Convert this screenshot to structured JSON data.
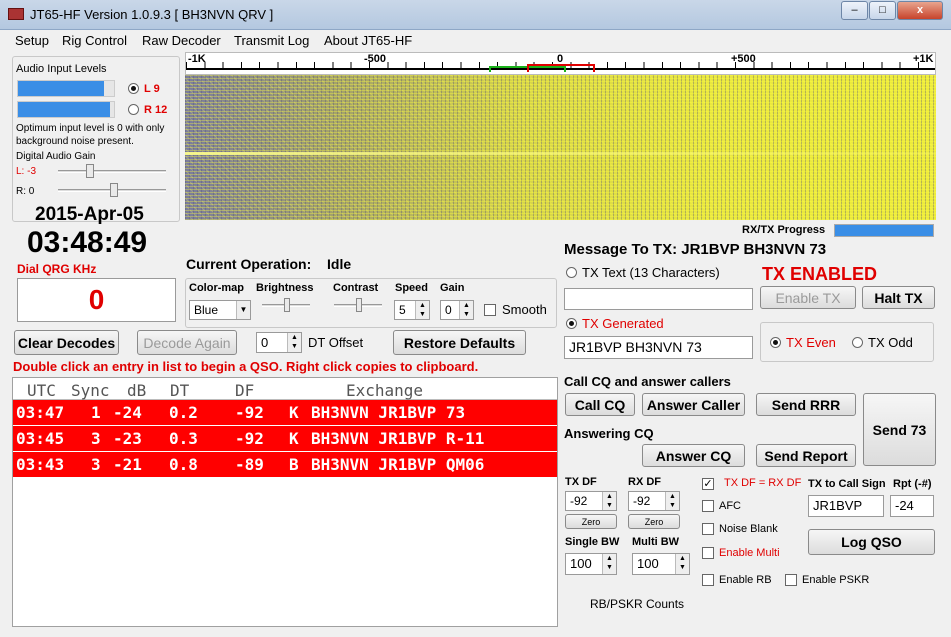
{
  "window": {
    "title": "JT65-HF Version 1.0.9.3  [ BH3NVN QRV ]",
    "minimize": "–",
    "maximize": "□",
    "close": "x"
  },
  "menu": [
    "Setup",
    "Rig Control",
    "Raw Decoder",
    "Transmit Log",
    "About JT65-HF"
  ],
  "audio": {
    "title": "Audio Input Levels",
    "left_label": "L 9",
    "right_label": "R 12",
    "left_level": 0.9,
    "right_level": 0.96,
    "hint": "Optimum input level is 0 with only background noise present.",
    "gain_title": "Digital Audio Gain",
    "gain_left": "L: -3",
    "gain_right": "R: 0"
  },
  "clock": {
    "date": "2015-Apr-05",
    "time": "03:48:49"
  },
  "dial": {
    "label": "Dial QRG KHz",
    "value": "0"
  },
  "scale": {
    "labels": [
      "-1K",
      "-500",
      "0",
      "+500",
      "+1K"
    ]
  },
  "progress": {
    "label": "RX/TX Progress",
    "fraction": 1.0
  },
  "operation": {
    "label": "Current Operation:",
    "value": "Idle"
  },
  "display": {
    "colormap_label": "Color-map",
    "colormap_value": "Blue",
    "brightness_label": "Brightness",
    "contrast_label": "Contrast",
    "speed_label": "Speed",
    "speed_value": "5",
    "gain_label": "Gain",
    "gain_value": "0",
    "smooth_label": "Smooth"
  },
  "buttons": {
    "clear_decodes": "Clear Decodes",
    "decode_again": "Decode Again",
    "restore_defaults": "Restore Defaults",
    "enable_tx": "Enable TX",
    "halt_tx": "Halt TX",
    "call_cq": "Call CQ",
    "answer_caller": "Answer Caller",
    "send_rrr": "Send RRR",
    "send_73": "Send 73",
    "answer_cq": "Answer CQ",
    "send_report": "Send Report",
    "zero": "Zero",
    "log_qso": "Log QSO"
  },
  "dt_offset": {
    "value": "0",
    "label": "DT Offset"
  },
  "instructions": "Double click an entry in list to begin a QSO.  Right click copies to clipboard.",
  "decodes": {
    "headers": [
      "UTC",
      "Sync",
      "dB",
      "DT",
      "DF",
      "Exchange"
    ],
    "rows": [
      {
        "utc": "03:47",
        "sync": "1",
        "db": "-24",
        "dt": "0.2",
        "df": "-92",
        "mode": "K",
        "exchange": "BH3NVN JR1BVP 73"
      },
      {
        "utc": "03:45",
        "sync": "3",
        "db": "-23",
        "dt": "0.3",
        "df": "-92",
        "mode": "K",
        "exchange": "BH3NVN JR1BVP R-11"
      },
      {
        "utc": "03:43",
        "sync": "3",
        "db": "-21",
        "dt": "0.8",
        "df": "-89",
        "mode": "B",
        "exchange": "BH3NVN JR1BVP QM06"
      }
    ]
  },
  "tx": {
    "message_title": "Message To TX: JR1BVP BH3NVN 73",
    "text_option": "TX Text (13 Characters)",
    "enabled_status": "TX ENABLED",
    "text_value": "",
    "generated_label": "TX Generated",
    "generated_value": "JR1BVP BH3NVN 73",
    "even_label": "TX Even",
    "odd_label": "TX Odd"
  },
  "qso": {
    "call_cq_title": "Call CQ and answer callers",
    "answering_title": "Answering CQ"
  },
  "df": {
    "tx_label": "TX DF",
    "tx_value": "-92",
    "rx_label": "RX DF",
    "rx_value": "-92",
    "tx_eq_rx": "TX DF = RX DF",
    "afc": "AFC",
    "noise_blank": "Noise Blank",
    "enable_multi": "Enable Multi",
    "enable_rb": "Enable RB",
    "enable_pskr": "Enable PSKR",
    "single_bw_label": "Single BW",
    "single_bw_value": "100",
    "multi_bw_label": "Multi BW",
    "multi_bw_value": "100"
  },
  "log": {
    "to_call_label": "TX to Call Sign",
    "to_call_value": "JR1BVP",
    "rpt_label": "Rpt (-#)",
    "rpt_value": "-24"
  },
  "footer": "RB/PSKR Counts"
}
